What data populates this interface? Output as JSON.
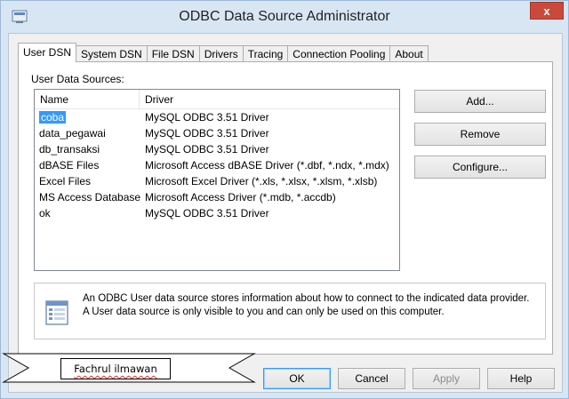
{
  "window": {
    "title": "ODBC Data Source Administrator",
    "close_glyph": "x"
  },
  "tabs": [
    {
      "label": "User DSN",
      "active": true
    },
    {
      "label": "System DSN"
    },
    {
      "label": "File DSN"
    },
    {
      "label": "Drivers"
    },
    {
      "label": "Tracing"
    },
    {
      "label": "Connection Pooling"
    },
    {
      "label": "About"
    }
  ],
  "panel": {
    "section_label": "User Data Sources:",
    "columns": {
      "name": "Name",
      "driver": "Driver"
    },
    "rows": [
      {
        "name": "coba",
        "driver": "MySQL ODBC 3.51 Driver",
        "selected": true
      },
      {
        "name": "data_pegawai",
        "driver": "MySQL ODBC 3.51 Driver"
      },
      {
        "name": "db_transaksi",
        "driver": "MySQL ODBC 3.51 Driver"
      },
      {
        "name": "dBASE Files",
        "driver": "Microsoft Access dBASE Driver (*.dbf, *.ndx, *.mdx)"
      },
      {
        "name": "Excel Files",
        "driver": "Microsoft Excel Driver (*.xls, *.xlsx, *.xlsm, *.xlsb)"
      },
      {
        "name": "MS Access Database",
        "driver": "Microsoft Access Driver (*.mdb, *.accdb)"
      },
      {
        "name": "ok",
        "driver": "MySQL ODBC 3.51 Driver"
      }
    ],
    "buttons": {
      "add": "Add...",
      "remove": "Remove",
      "configure": "Configure..."
    },
    "info_text": "An ODBC User data source stores information about how to connect to the indicated data provider.   A User data source is only visible to you and can only be used on this computer."
  },
  "footer": {
    "ok": "OK",
    "cancel": "Cancel",
    "apply": "Apply",
    "help": "Help"
  },
  "banner": {
    "label": "Fachrul ilmawan"
  },
  "colors": {
    "selection": "#3399ff",
    "close_button": "#c94a3b",
    "frame": "#d8e6f3"
  },
  "icons": {
    "title": "odbc-app-icon",
    "info": "data-source-document-icon",
    "close": "close-icon"
  }
}
